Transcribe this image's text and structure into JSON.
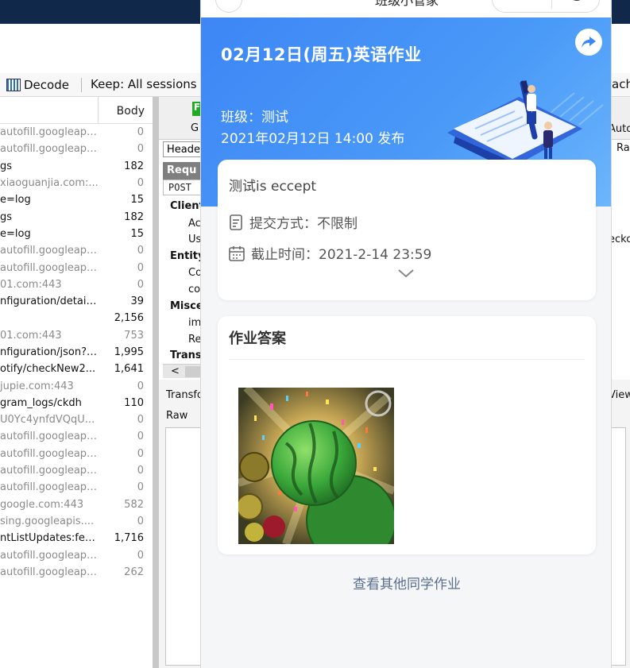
{
  "toolbar": {
    "decode_label": "Decode",
    "keep_label": "Keep: All sessions",
    "right_fragment": "ach"
  },
  "sessions": {
    "body_header": "Body",
    "rows": [
      {
        "url": "autofill.googleapi...",
        "body": "0",
        "style": "dim"
      },
      {
        "url": "autofill.googleapi...",
        "body": "0",
        "style": "dim"
      },
      {
        "url": "gs",
        "body": "182",
        "style": "dark"
      },
      {
        "url": "xiaoguanjia.com:...",
        "body": "0",
        "style": "dim"
      },
      {
        "url": "e=log",
        "body": "15",
        "style": "dark"
      },
      {
        "url": "gs",
        "body": "182",
        "style": "dark"
      },
      {
        "url": "e=log",
        "body": "15",
        "style": "dark"
      },
      {
        "url": "autofill.googleapi...",
        "body": "0",
        "style": "dim"
      },
      {
        "url": "autofill.googleapi...",
        "body": "0",
        "style": "dim"
      },
      {
        "url": "01.com:443",
        "body": "0",
        "style": "dim"
      },
      {
        "url": "nfiguration/detail...",
        "body": "39",
        "style": "dark"
      },
      {
        "url": "",
        "body": "2,156",
        "style": "dark"
      },
      {
        "url": "01.com:443",
        "body": "753",
        "style": "dim"
      },
      {
        "url": "nfiguration/json?t...",
        "body": "1,995",
        "style": "dark"
      },
      {
        "url": "otify/checkNew2...",
        "body": "1,641",
        "style": "dark"
      },
      {
        "url": "jupie.com:443",
        "body": "0",
        "style": "dim"
      },
      {
        "url": "gram_logs/ckdh",
        "body": "110",
        "style": "dark"
      },
      {
        "url": "U0Yc4ynfdVQqU...",
        "body": "0",
        "style": "dim"
      },
      {
        "url": "autofill.googleapi...",
        "body": "0",
        "style": "dim"
      },
      {
        "url": "autofill.googleapi...",
        "body": "0",
        "style": "dim"
      },
      {
        "url": "autofill.googleapi...",
        "body": "0",
        "style": "dim"
      },
      {
        "url": "autofill.googleapi...",
        "body": "0",
        "style": "dim"
      },
      {
        "url": "google.com:443",
        "body": "582",
        "style": "dim"
      },
      {
        "url": "sing.googleapis....",
        "body": "0",
        "style": "dim"
      },
      {
        "url": "ntListUpdates:fet...",
        "body": "1,716",
        "style": "dark"
      },
      {
        "url": "autofill.googleapi...",
        "body": "0",
        "style": "dim"
      },
      {
        "url": "autofill.googleapi...",
        "body": "262",
        "style": "dim"
      }
    ]
  },
  "inspector": {
    "green_tab": "F",
    "tab_fragment": "G",
    "headers_tab": "Header",
    "request_label": "Requ",
    "post_label": "POST",
    "client_label": "Client",
    "client_items": [
      "Ac",
      "Us"
    ],
    "entity_label": "Entity",
    "entity_items": [
      "Co",
      "co"
    ],
    "misc_label": "Misce",
    "misc_items": [
      "imp",
      "Re"
    ],
    "trans_label": "Trans",
    "scroll_left": "<",
    "transform_label": "Transfo",
    "raw_label": "Raw",
    "right_auto": "Auto",
    "right_ra": "Ra",
    "right_gecko": "ecko",
    "right_view": "View"
  },
  "phone": {
    "nav_title": "班级小管家",
    "hero": {
      "title": "02月12日(周五)英语作业",
      "class_line": "班级：测试",
      "date_line": "2021年02月12日 14:00 发布"
    },
    "card": {
      "description": "测试is eccept",
      "submit_label": "提交方式：",
      "submit_value": "不限制",
      "deadline_label": "截止时间：",
      "deadline_value": "2021-2-14 23:59"
    },
    "answers": {
      "heading": "作业答案"
    },
    "others_link": "查看其他同学作业"
  }
}
